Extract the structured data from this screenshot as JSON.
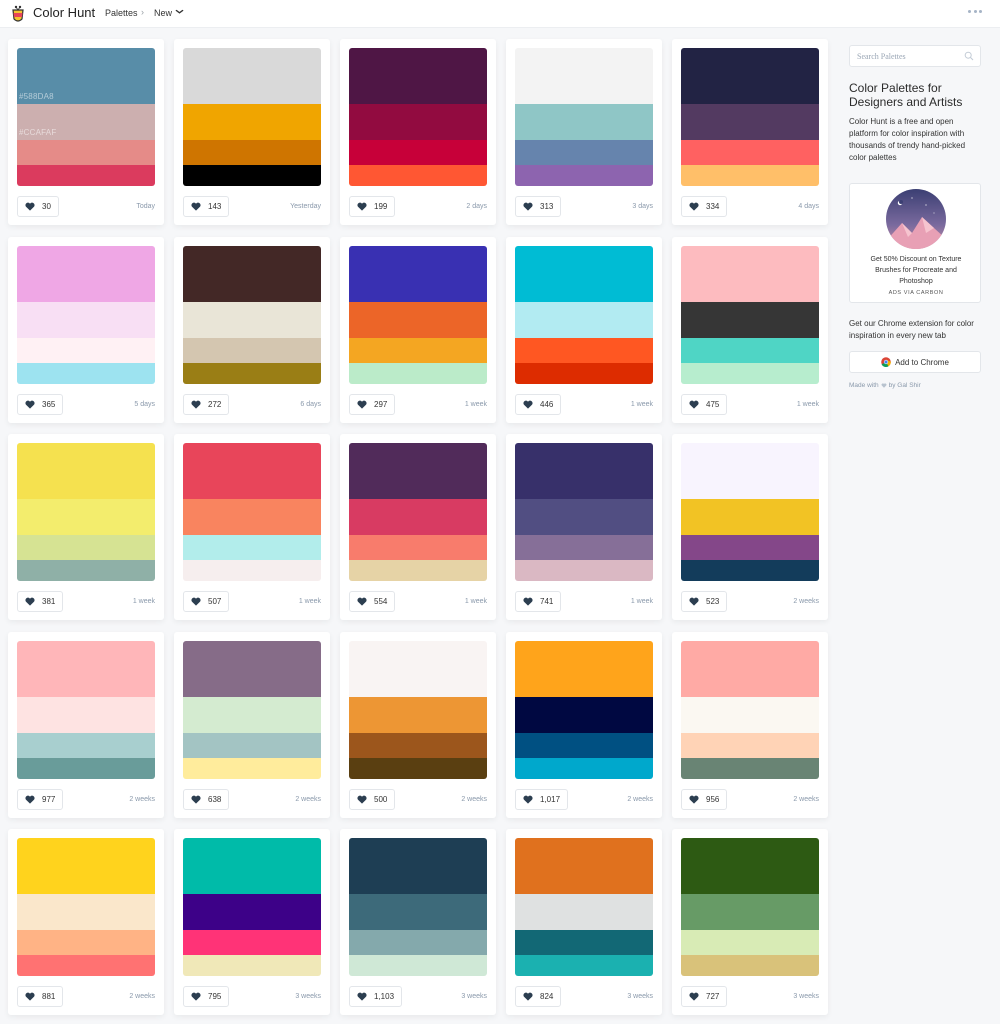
{
  "header": {
    "brand": "Color Hunt",
    "nav_palettes": "Palettes",
    "nav_separator": "›",
    "nav_new": "New",
    "chevron_icon": "chevron-down-icon",
    "more_icon": "more-dots-icon"
  },
  "palettes": [
    {
      "colors": [
        "#588DA8",
        "#CCAFAF",
        "#E58B88",
        "#DB3B5E"
      ],
      "hex_labels": [
        "#588DA8",
        "#CCAFAF",
        "",
        ""
      ],
      "likes": "30",
      "age": "Today"
    },
    {
      "colors": [
        "#D9D9D9",
        "#F0A500",
        "#CF7500",
        "#000000"
      ],
      "hex_labels": [
        "",
        "",
        "",
        ""
      ],
      "likes": "143",
      "age": "Yesterday"
    },
    {
      "colors": [
        "#4F1645",
        "#920B40",
        "#C70039",
        "#FF5733"
      ],
      "hex_labels": [
        "",
        "",
        "",
        ""
      ],
      "likes": "199",
      "age": "2 days"
    },
    {
      "colors": [
        "#F3F3F3",
        "#8FC6C6",
        "#6684AD",
        "#8D64AF"
      ],
      "hex_labels": [
        "",
        "",
        "",
        ""
      ],
      "likes": "313",
      "age": "3 days"
    },
    {
      "colors": [
        "#222344",
        "#533A61",
        "#FF6161",
        "#FFBF69"
      ],
      "hex_labels": [
        "",
        "",
        "",
        ""
      ],
      "likes": "334",
      "age": "4 days"
    },
    {
      "colors": [
        "#EFA7E5",
        "#F8DFF4",
        "#FFF1F4",
        "#9DE3F0"
      ],
      "hex_labels": [
        "",
        "",
        "",
        ""
      ],
      "likes": "365",
      "age": "5 days"
    },
    {
      "colors": [
        "#432826",
        "#E9E5D7",
        "#D4C6B0",
        "#9A7E15"
      ],
      "hex_labels": [
        "",
        "",
        "",
        ""
      ],
      "likes": "272",
      "age": "6 days"
    },
    {
      "colors": [
        "#3930B2",
        "#EC6528",
        "#F4A622",
        "#BBEBC9"
      ],
      "hex_labels": [
        "",
        "",
        "",
        ""
      ],
      "likes": "297",
      "age": "1 week"
    },
    {
      "colors": [
        "#00BCD4",
        "#B2EBF2",
        "#FF5722",
        "#DD2C00"
      ],
      "hex_labels": [
        "",
        "",
        "",
        ""
      ],
      "likes": "446",
      "age": "1 week"
    },
    {
      "colors": [
        "#FDBBBF",
        "#363636",
        "#4FD5C5",
        "#B7EDCE"
      ],
      "hex_labels": [
        "",
        "",
        "",
        ""
      ],
      "likes": "475",
      "age": "1 week"
    },
    {
      "colors": [
        "#F5E14F",
        "#F3ED6D",
        "#D6E393",
        "#8FB0A7"
      ],
      "hex_labels": [
        "",
        "",
        "",
        ""
      ],
      "likes": "381",
      "age": "1 week"
    },
    {
      "colors": [
        "#E8455A",
        "#F9845F",
        "#B2EDEB",
        "#F6EEEE"
      ],
      "hex_labels": [
        "",
        "",
        "",
        ""
      ],
      "likes": "507",
      "age": "1 week"
    },
    {
      "colors": [
        "#512B5A",
        "#D83B62",
        "#F87C6C",
        "#E6D3A6"
      ],
      "hex_labels": [
        "",
        "",
        "",
        ""
      ],
      "likes": "554",
      "age": "1 week"
    },
    {
      "colors": [
        "#37306A",
        "#514E82",
        "#866F98",
        "#DAB8C3"
      ],
      "hex_labels": [
        "",
        "",
        "",
        ""
      ],
      "likes": "741",
      "age": "1 week"
    },
    {
      "colors": [
        "#F8F4FE",
        "#F2C324",
        "#844789",
        "#133C5B"
      ],
      "hex_labels": [
        "",
        "",
        "",
        ""
      ],
      "likes": "523",
      "age": "2 weeks"
    },
    {
      "colors": [
        "#FFB6B9",
        "#FEE3E2",
        "#A8CFCF",
        "#699C9A"
      ],
      "hex_labels": [
        "",
        "",
        "",
        ""
      ],
      "likes": "977",
      "age": "2 weeks"
    },
    {
      "colors": [
        "#866C88",
        "#D4EBD0",
        "#A3C4C3",
        "#FFEC9C"
      ],
      "hex_labels": [
        "",
        "",
        "",
        ""
      ],
      "likes": "638",
      "age": "2 weeks"
    },
    {
      "colors": [
        "#F9F4F3",
        "#ED9634",
        "#9C561C",
        "#5A3F11"
      ],
      "hex_labels": [
        "",
        "",
        "",
        ""
      ],
      "likes": "500",
      "age": "2 weeks"
    },
    {
      "colors": [
        "#FFA41B",
        "#000841",
        "#005082",
        "#00A8CC"
      ],
      "hex_labels": [
        "",
        "",
        "",
        ""
      ],
      "likes": "1,017",
      "age": "2 weeks"
    },
    {
      "colors": [
        "#FFAAA5",
        "#FBF8F2",
        "#FFD3B6",
        "#698474"
      ],
      "hex_labels": [
        "",
        "",
        "",
        ""
      ],
      "likes": "956",
      "age": "2 weeks"
    },
    {
      "colors": [
        "#FFD31D",
        "#FAE7CB",
        "#FFB385",
        "#FF7272"
      ],
      "hex_labels": [
        "",
        "",
        "",
        ""
      ],
      "likes": "881",
      "age": "2 weeks"
    },
    {
      "colors": [
        "#00BBA9",
        "#3D0188",
        "#FF3377",
        "#F0E8B8"
      ],
      "hex_labels": [
        "",
        "",
        "",
        ""
      ],
      "likes": "795",
      "age": "3 weeks"
    },
    {
      "colors": [
        "#1E3E54",
        "#3D6A7A",
        "#84A9AC",
        "#CFE8D6"
      ],
      "hex_labels": [
        "",
        "",
        "",
        ""
      ],
      "likes": "1,103",
      "age": "3 weeks"
    },
    {
      "colors": [
        "#E0711E",
        "#DFE1E1",
        "#126875",
        "#1BB1B0"
      ],
      "hex_labels": [
        "",
        "",
        "",
        ""
      ],
      "likes": "824",
      "age": "3 weeks"
    },
    {
      "colors": [
        "#2D5A13",
        "#679B66",
        "#D8EBB5",
        "#D9C27A"
      ],
      "hex_labels": [
        "",
        "",
        "",
        ""
      ],
      "likes": "727",
      "age": "3 weeks"
    }
  ],
  "sidebar": {
    "search_placeholder": "Search Palettes",
    "title": "Color Palettes for Designers and Artists",
    "description": "Color Hunt is a free and open platform for color inspiration with thousands of trendy hand-picked color palettes",
    "ad_text": "Get 50% Discount on Texture Brushes for Procreate and Photoshop",
    "ad_via": "ADS VIA CARBON",
    "extension_text": "Get our Chrome extension for color inspiration in every new tab",
    "chrome_button": "Add to Chrome",
    "made_with_prefix": "Made with",
    "made_with_suffix": "by Gal Shir"
  },
  "colors": {
    "background": "#f6f7f9",
    "heart": "#2c3e50",
    "muted_text": "#8a99ab"
  }
}
